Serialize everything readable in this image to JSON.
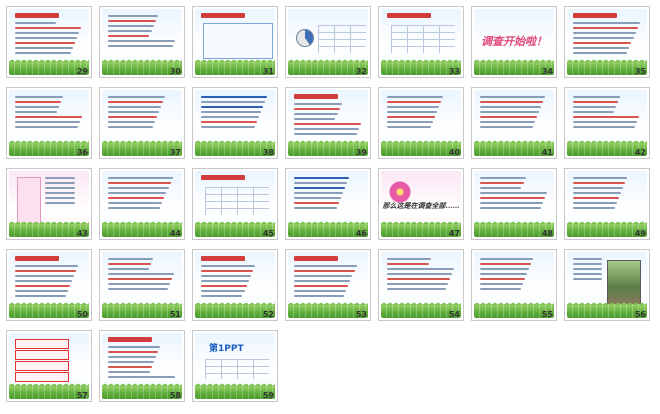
{
  "view": "slide-sorter",
  "accent_color": "#3b78d8",
  "slides": [
    {
      "n": 29,
      "row": 0,
      "col": 0,
      "style": "lines-red-title",
      "title": "课本135-136页"
    },
    {
      "n": 30,
      "row": 0,
      "col": 1,
      "style": "lines"
    },
    {
      "n": 31,
      "row": 0,
      "col": 2,
      "style": "box-lines"
    },
    {
      "n": 32,
      "row": 0,
      "col": 3,
      "style": "pie-table"
    },
    {
      "n": 33,
      "row": 0,
      "col": 4,
      "style": "table",
      "title": "156页第一题"
    },
    {
      "n": 34,
      "row": 0,
      "col": 5,
      "style": "big-text",
      "text": "调查开始啦！"
    },
    {
      "n": 35,
      "row": 0,
      "col": 6,
      "style": "lines-red-title",
      "title": "157页一题"
    },
    {
      "n": 36,
      "row": 1,
      "col": 0,
      "style": "lines"
    },
    {
      "n": 37,
      "row": 1,
      "col": 1,
      "style": "lines"
    },
    {
      "n": 38,
      "row": 1,
      "col": 2,
      "style": "lines-blue",
      "text": "课本157页第5题"
    },
    {
      "n": 39,
      "row": 1,
      "col": 3,
      "style": "lines-red-title"
    },
    {
      "n": 40,
      "row": 1,
      "col": 4,
      "style": "lines"
    },
    {
      "n": 41,
      "row": 1,
      "col": 5,
      "style": "lines"
    },
    {
      "n": 42,
      "row": 1,
      "col": 6,
      "style": "lines"
    },
    {
      "n": 43,
      "row": 2,
      "col": 0,
      "style": "pink-box"
    },
    {
      "n": 44,
      "row": 2,
      "col": 1,
      "style": "lines"
    },
    {
      "n": 45,
      "row": 2,
      "col": 2,
      "style": "table",
      "title": "实践与探究"
    },
    {
      "n": 46,
      "row": 2,
      "col": 3,
      "style": "lines-blue"
    },
    {
      "n": 47,
      "row": 2,
      "col": 4,
      "style": "flower-text",
      "text": "那么这是在调查全部……"
    },
    {
      "n": 48,
      "row": 2,
      "col": 5,
      "style": "lines"
    },
    {
      "n": 49,
      "row": 2,
      "col": 6,
      "style": "lines"
    },
    {
      "n": 50,
      "row": 3,
      "col": 0,
      "style": "lines-red-title"
    },
    {
      "n": 51,
      "row": 3,
      "col": 1,
      "style": "lines"
    },
    {
      "n": 52,
      "row": 3,
      "col": 2,
      "style": "lines-red-title"
    },
    {
      "n": 53,
      "row": 3,
      "col": 3,
      "style": "lines-red-title",
      "title": "练一练"
    },
    {
      "n": 54,
      "row": 3,
      "col": 4,
      "style": "lines"
    },
    {
      "n": 55,
      "row": 3,
      "col": 5,
      "style": "lines"
    },
    {
      "n": 56,
      "row": 3,
      "col": 6,
      "style": "photo"
    },
    {
      "n": 57,
      "row": 4,
      "col": 0,
      "style": "red-boxes"
    },
    {
      "n": 58,
      "row": 4,
      "col": 1,
      "style": "lines-red-title",
      "title": "练习（用方程解答）"
    },
    {
      "n": 59,
      "row": 4,
      "col": 2,
      "style": "logo",
      "text": "第1PPT"
    }
  ]
}
